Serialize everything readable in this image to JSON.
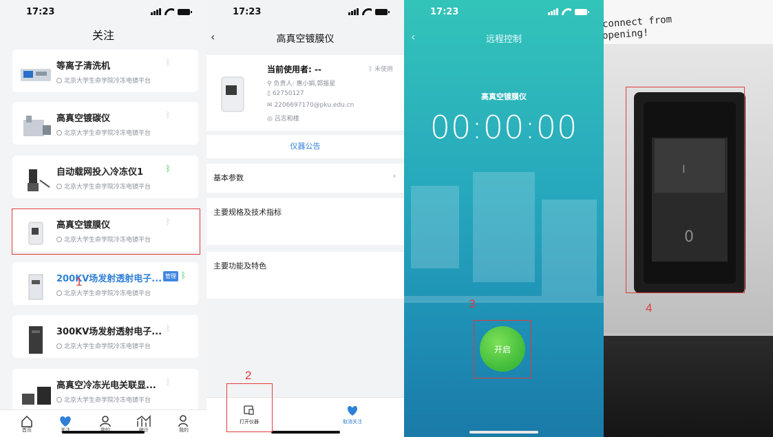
{
  "panel1": {
    "status_time": "17:23",
    "title": "关注",
    "items": [
      {
        "name": "等离子清洗机",
        "location": "北京大学生命学院冷冻电镜平台"
      },
      {
        "name": "高真空镀碳仪",
        "location": "北京大学生命学院冷冻电镜平台"
      },
      {
        "name": "自动载网投入冷冻仪1",
        "location": "北京大学生命学院冷冻电镜平台",
        "bluetooth_active": true
      },
      {
        "name": "高真空镀膜仪",
        "location": "北京大学生命学院冷冻电镜平台"
      },
      {
        "name": "200KV场发射透射电子...",
        "location": "北京大学生命学院冷冻电镜平台",
        "badge": "管理",
        "bluetooth_active": true
      },
      {
        "name": "300KV场发射透射电子...",
        "location": "北京大学生命学院冷冻电镜平台"
      },
      {
        "name": "高真空冷冻光电关联显...",
        "location": "北京大学生命学院冷冻电镜平台"
      }
    ],
    "tabs": [
      "首页",
      "关注",
      "我的",
      "统计",
      "我的"
    ]
  },
  "panel2": {
    "status_time": "17:23",
    "title": "高真空镀膜仪",
    "current_user_label": "当前使用者: --",
    "status": "未使用",
    "manager": "负责人: 惠小娟,郭振星",
    "phone": "62750127",
    "email": "2206697170@pku.edu.cn",
    "location": "吕志和楼",
    "notice_label": "仪器公告",
    "sections": [
      "基本参数",
      "主要规格及技术指标",
      "主要功能及特色"
    ],
    "open_label": "打开仪器",
    "unfollow_label": "取消关注"
  },
  "panel3": {
    "status_time": "17:23",
    "title": "远程控制",
    "instrument": "高真空镀膜仪",
    "timer": "00:00:00",
    "start_label": "开启"
  },
  "panel4": {
    "label_line1": "connect from",
    "label_line2": "opening!",
    "switch_on_mark": "I",
    "switch_off_mark": "0"
  },
  "annotations": [
    "1",
    "2",
    "3",
    "4"
  ],
  "colors": {
    "accent_blue": "#2f7fd6",
    "annotation_red": "#e23a3a",
    "start_green": "#3fbb3a",
    "teal_top": "#33c4b9"
  }
}
